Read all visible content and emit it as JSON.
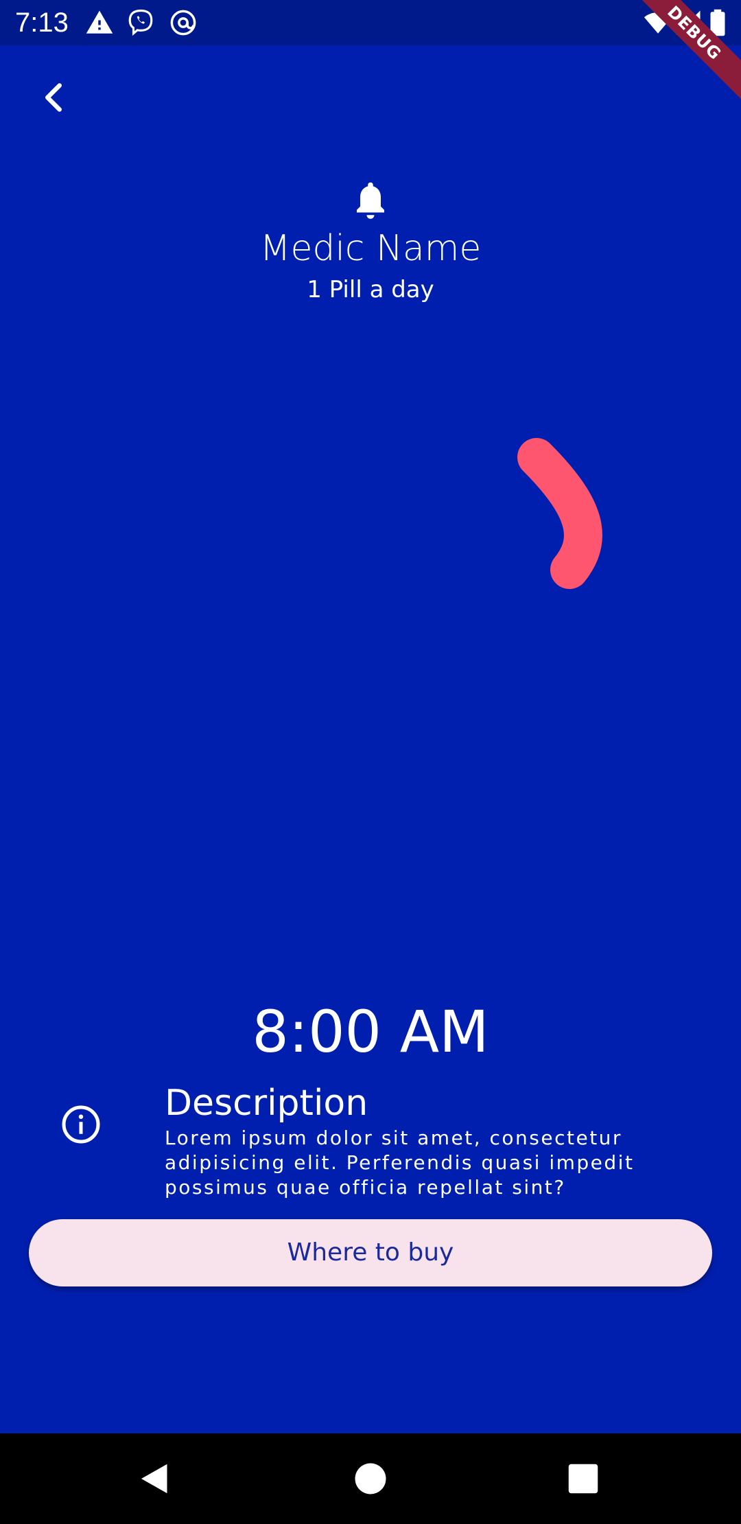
{
  "status_bar": {
    "time": "7:13",
    "icons": [
      "warning-icon",
      "viber-icon",
      "at-sign-icon",
      "wifi-icon",
      "signal-icon",
      "battery-icon"
    ],
    "debug_label": "DEBUG"
  },
  "header": {
    "back_icon": "chevron-left-icon",
    "bell_icon": "bell-icon",
    "medic_name": "Medic Name",
    "dosage": "1 Pill a day"
  },
  "pill": {
    "icon": "capsule-pill-icon",
    "colors": {
      "red_light": "#ff5670",
      "red_dark": "#f23652",
      "white_light": "#f5f6fa",
      "white_dark": "#e5e7ec"
    }
  },
  "time": "8:00 AM",
  "description": {
    "icon": "info-icon",
    "title": "Description",
    "text": "Lorem ipsum dolor sit amet, consectetur adipisicing elit. Perferendis quasi impedit possimus quae officia repellat sint?"
  },
  "buy_button": {
    "label": "Where to buy"
  },
  "nav_bar": {
    "back": "triangle-back-icon",
    "home": "circle-home-icon",
    "recents": "square-recents-icon"
  },
  "colors": {
    "background": "#001fae",
    "button_bg": "#f8e2ec",
    "button_text": "#1a2a9e"
  }
}
